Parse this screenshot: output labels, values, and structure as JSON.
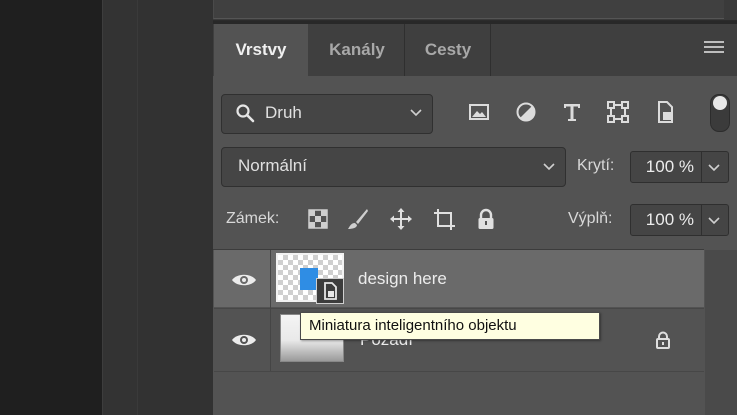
{
  "panel": {
    "tabs": [
      {
        "label": "Vrstvy",
        "active": true
      },
      {
        "label": "Kanály",
        "active": false
      },
      {
        "label": "Cesty",
        "active": false
      }
    ],
    "menu_icon": "hamburger-menu-icon"
  },
  "filter": {
    "search_icon": "search-icon",
    "selected": "Druh",
    "icons": [
      "image-filter-icon",
      "adjustment-filter-icon",
      "type-filter-icon",
      "shape-filter-icon",
      "smart-object-filter-icon"
    ]
  },
  "blend": {
    "mode": "Normální",
    "opacity_label": "Krytí:",
    "opacity_value": "100 %"
  },
  "lock": {
    "label": "Zámek:",
    "icons": [
      "lock-transparent-pixels-icon",
      "lock-image-pixels-icon",
      "lock-position-icon",
      "lock-artboard-icon",
      "lock-all-icon"
    ],
    "fill_label": "Výplň:",
    "fill_value": "100 %"
  },
  "layers": [
    {
      "name": "design here",
      "visible": true,
      "selected": true,
      "type": "smart-object"
    },
    {
      "name": "Pozadí",
      "visible": true,
      "selected": false,
      "locked": true
    }
  ],
  "tooltip": {
    "text": "Miniatura inteligentního objektu"
  },
  "colors": {
    "panel_bg": "#535353",
    "selected_row": "#6a6a6a",
    "tooltip_bg": "#ffffe1",
    "smart_object_blue": "#2f8de4"
  }
}
